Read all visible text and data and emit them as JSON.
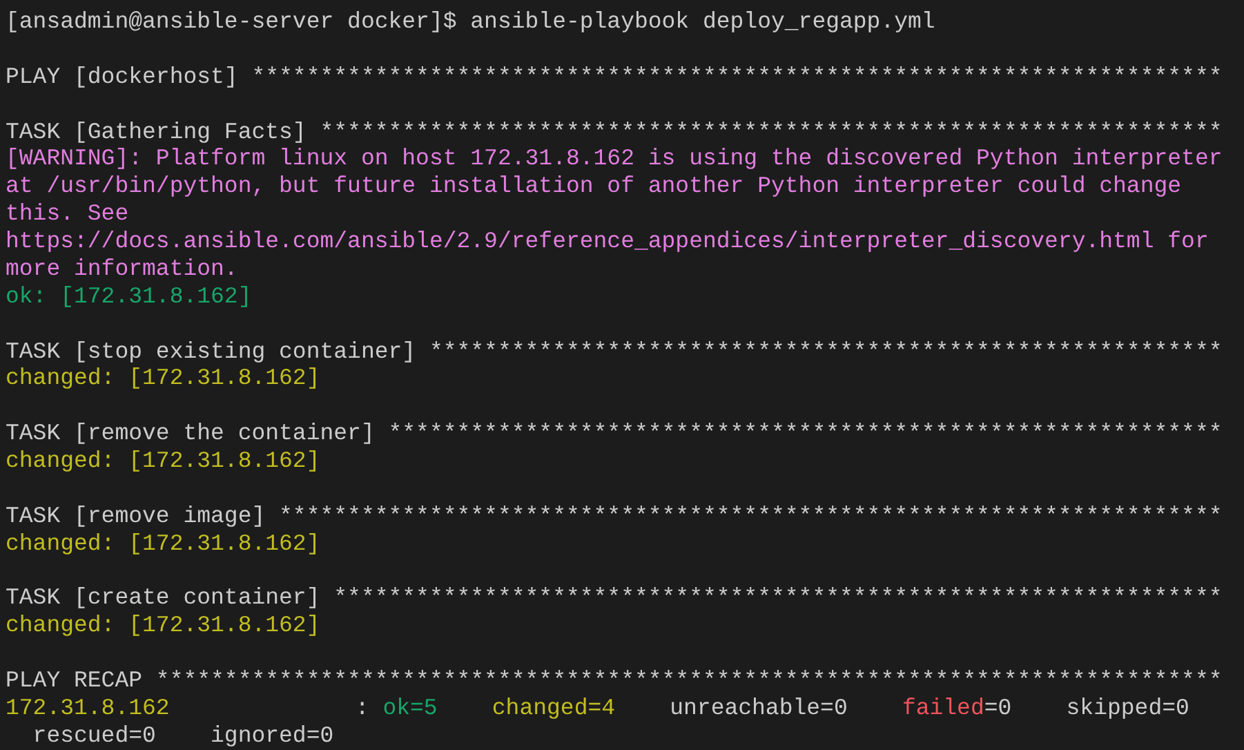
{
  "terminal": {
    "lines": [
      {
        "kind": "command",
        "text": "[ansadmin@ansible-server docker]$ ansible-playbook deploy_regapp.yml"
      },
      {
        "kind": "blank"
      },
      {
        "kind": "header",
        "text": "PLAY [dockerhost] ***********************************************************************"
      },
      {
        "kind": "blank"
      },
      {
        "kind": "header",
        "text": "TASK [Gathering Facts] ******************************************************************"
      },
      {
        "kind": "warning",
        "text": "[WARNING]: Platform linux on host 172.31.8.162 is using the discovered Python interpreter"
      },
      {
        "kind": "warning",
        "text": "at /usr/bin/python, but future installation of another Python interpreter could change"
      },
      {
        "kind": "warning",
        "text": "this. See"
      },
      {
        "kind": "warning",
        "text": "https://docs.ansible.com/ansible/2.9/reference_appendices/interpreter_discovery.html for"
      },
      {
        "kind": "warning",
        "text": "more information."
      },
      {
        "kind": "ok",
        "text": "ok: [172.31.8.162]"
      },
      {
        "kind": "blank"
      },
      {
        "kind": "header",
        "text": "TASK [stop existing container] **********************************************************"
      },
      {
        "kind": "changed",
        "text": "changed: [172.31.8.162]"
      },
      {
        "kind": "blank"
      },
      {
        "kind": "header",
        "text": "TASK [remove the container] *************************************************************"
      },
      {
        "kind": "changed",
        "text": "changed: [172.31.8.162]"
      },
      {
        "kind": "blank"
      },
      {
        "kind": "header",
        "text": "TASK [remove image] *********************************************************************"
      },
      {
        "kind": "changed",
        "text": "changed: [172.31.8.162]"
      },
      {
        "kind": "blank"
      },
      {
        "kind": "header",
        "text": "TASK [create container] *****************************************************************"
      },
      {
        "kind": "changed",
        "text": "changed: [172.31.8.162]"
      },
      {
        "kind": "blank"
      },
      {
        "kind": "header",
        "text": "PLAY RECAP ******************************************************************************"
      }
    ],
    "recap": {
      "host": "172.31.8.162",
      "separator": ":",
      "rows": [
        [
          {
            "label": "ok",
            "value": "=5",
            "kind": "ok"
          },
          {
            "label": "changed",
            "value": "=4",
            "kind": "changed"
          },
          {
            "label": "unreachable",
            "value": "=0",
            "kind": "plain"
          },
          {
            "label": "failed",
            "value": "=0",
            "kind": "failed"
          },
          {
            "label": "skipped",
            "value": "=0",
            "kind": "plain"
          }
        ],
        [
          {
            "label": "rescued",
            "value": "=0",
            "kind": "plain"
          },
          {
            "label": "ignored",
            "value": "=0",
            "kind": "plain"
          }
        ]
      ]
    }
  }
}
